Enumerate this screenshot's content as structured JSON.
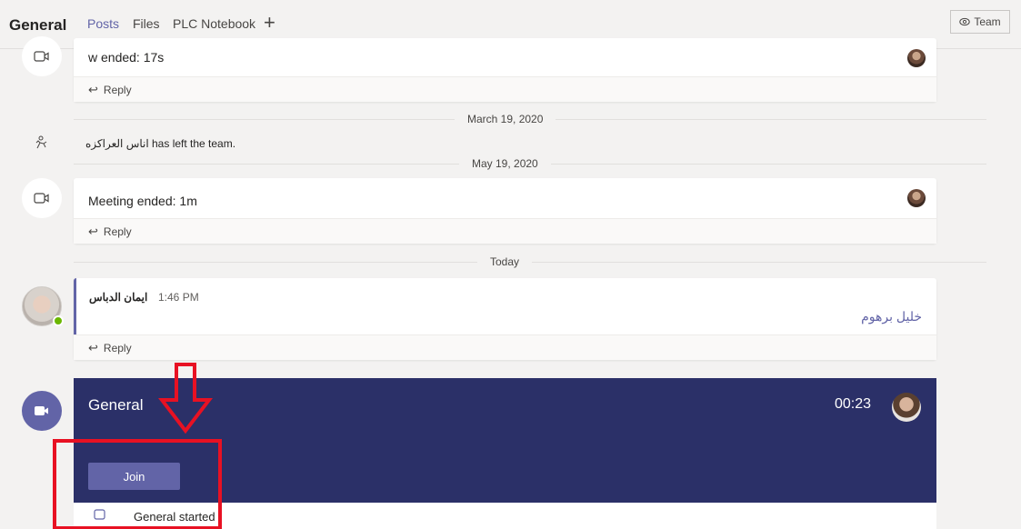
{
  "header": {
    "channel": "General",
    "tabs": [
      {
        "label": "Posts",
        "active": true
      },
      {
        "label": "Files",
        "active": false
      },
      {
        "label": "PLC Notebook",
        "active": false
      }
    ],
    "add_tab_glyph": "+",
    "team_button": "Team"
  },
  "feed": {
    "top_card": {
      "title": "w ended: 17s",
      "reply": "Reply"
    },
    "divider1": "March 19, 2020",
    "system_message": "اناس العراكزه has left the team.",
    "divider2": "May 19, 2020",
    "meeting_card": {
      "title": "Meeting ended: 1m",
      "reply": "Reply"
    },
    "divider3": "Today",
    "post": {
      "author": "ايمان الدباس",
      "time": "1:46 PM",
      "body": "خليل برهوم",
      "reply": "Reply"
    },
    "live_meeting": {
      "title": "General",
      "timer": "00:23",
      "join_label": "Join",
      "footer": "General started"
    }
  },
  "colors": {
    "accent": "#6264a7",
    "meeting_bg": "#2b3068",
    "annotation_red": "#e81123",
    "presence_green": "#6bb700"
  }
}
